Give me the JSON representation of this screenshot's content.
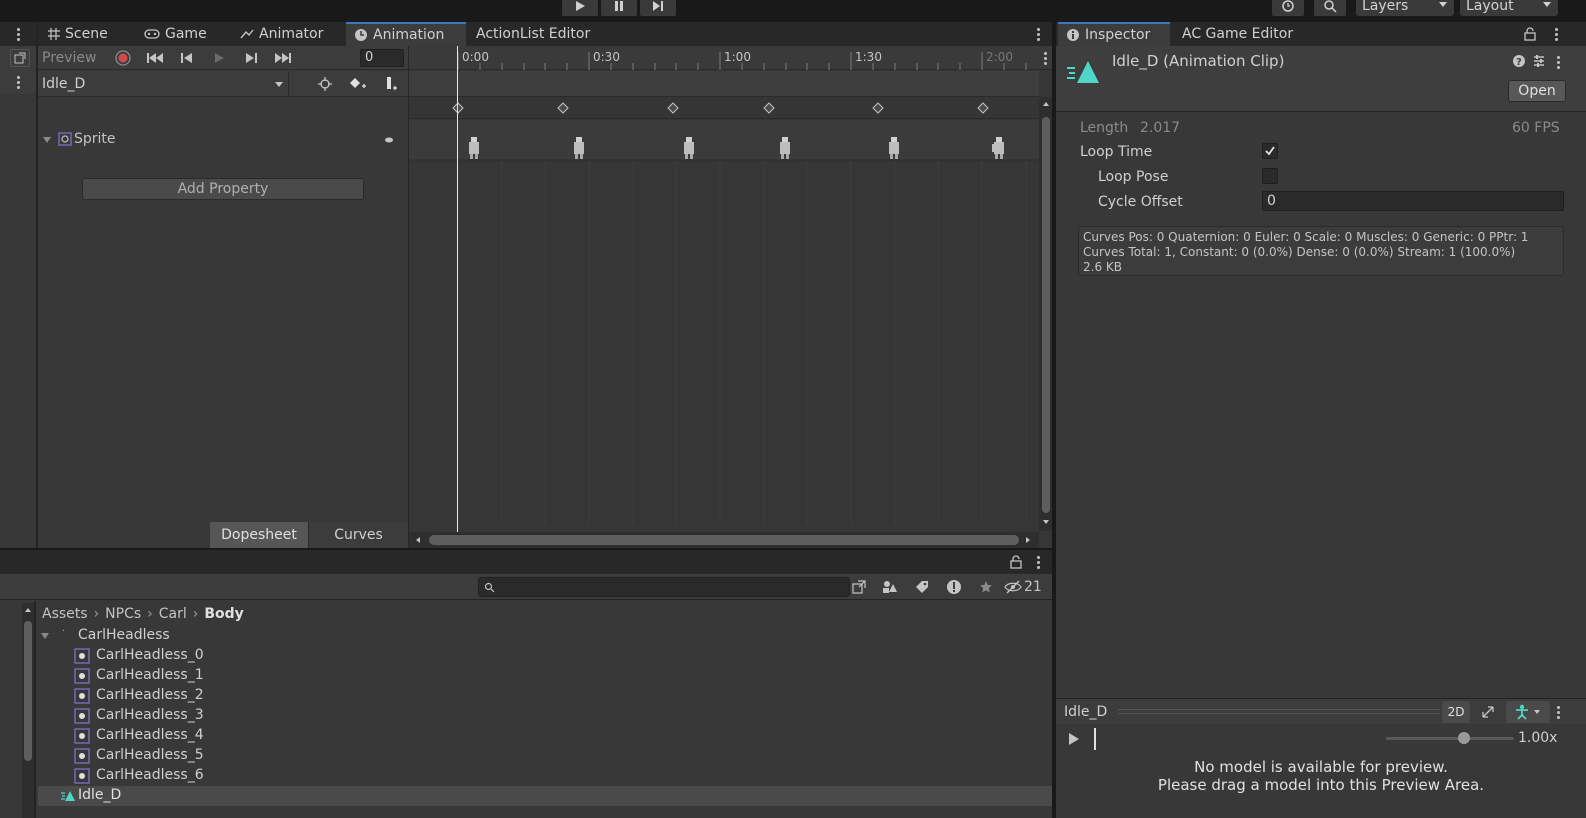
{
  "toolbar": {
    "layers_label": "Layers",
    "layout_label": "Layout"
  },
  "center_tabs": [
    "Scene",
    "Game",
    "Animator",
    "Animation",
    "ActionList Editor"
  ],
  "animation": {
    "preview_label": "Preview",
    "frame_value": "0",
    "clip_name": "Idle_D",
    "property_name": "Sprite",
    "add_property_label": "Add Property",
    "dopesheet_label": "Dopesheet",
    "curves_label": "Curves",
    "ruler_labels": [
      "0:00",
      "0:30",
      "1:00",
      "1:30",
      "2:00"
    ]
  },
  "project": {
    "hidden_count": "21",
    "breadcrumb": [
      "Assets",
      "NPCs",
      "Carl",
      "Body"
    ],
    "parent_item": "CarlHeadless",
    "items": [
      "CarlHeadless_0",
      "CarlHeadless_1",
      "CarlHeadless_2",
      "CarlHeadless_3",
      "CarlHeadless_4",
      "CarlHeadless_5",
      "CarlHeadless_6"
    ],
    "selected_item": "Idle_D"
  },
  "inspector": {
    "tabs": [
      "Inspector",
      "AC Game Editor"
    ],
    "title": "Idle_D (Animation Clip)",
    "open_label": "Open",
    "length_label": "Length",
    "length_value": "2.017",
    "fps_label": "60 FPS",
    "loop_time_label": "Loop Time",
    "loop_time_checked": true,
    "loop_pose_label": "Loop Pose",
    "loop_pose_checked": false,
    "cycle_offset_label": "Cycle Offset",
    "cycle_offset_value": "0",
    "info_line1": "Curves Pos: 0 Quaternion: 0 Euler: 0 Scale: 0 Muscles: 0 Generic: 0 PPtr: 1",
    "info_line2": "Curves Total: 1, Constant: 0 (0.0%) Dense: 0 (0.0%) Stream: 1 (100.0%)",
    "info_line3": "2.6 KB"
  },
  "preview": {
    "name": "Idle_D",
    "mode_2d": "2D",
    "speed": "1.00x",
    "speed_fraction": 0.61,
    "msg1": "No model is available for preview.",
    "msg2": "Please drag a model into this Preview Area."
  },
  "colors": {
    "accent": "#3a79bb",
    "selected_tab_line": "#3a79bb",
    "record": "#d44b4b",
    "clip_icon": "#4fd6c6",
    "sprite_icon": "#7e6ab8"
  }
}
